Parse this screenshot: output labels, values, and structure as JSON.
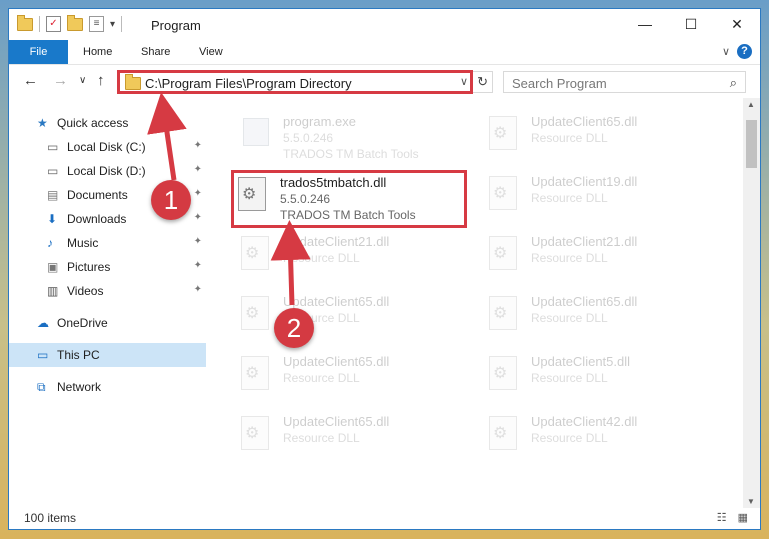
{
  "window": {
    "title": "Program",
    "controls": {
      "minimize": "—",
      "maximize": "☐",
      "close": "✕"
    }
  },
  "ribbon": {
    "tabs": [
      "File",
      "Home",
      "Share",
      "View"
    ],
    "help": "?",
    "expand": "∨"
  },
  "navigation": {
    "back": "←",
    "forward": "→",
    "recent": "∨",
    "up": "↑",
    "address": "C:\\Program Files\\Program Directory",
    "address_dropdown": "∨",
    "refresh": "↻",
    "search_placeholder": "Search Program",
    "search_icon": "⌕"
  },
  "sidebar": {
    "items": [
      {
        "label": "Quick access",
        "icon": "star-icon",
        "pinned": false
      },
      {
        "label": "Local Disk (C:)",
        "icon": "drive-icon",
        "pinned": true
      },
      {
        "label": "Local Disk (D:)",
        "icon": "drive-icon",
        "pinned": true
      },
      {
        "label": "Documents",
        "icon": "documents-icon",
        "pinned": true
      },
      {
        "label": "Downloads",
        "icon": "download-arrow-icon",
        "pinned": true
      },
      {
        "label": "Music",
        "icon": "music-note-icon",
        "pinned": true
      },
      {
        "label": "Pictures",
        "icon": "pictures-icon",
        "pinned": true
      },
      {
        "label": "Videos",
        "icon": "film-icon",
        "pinned": true
      },
      {
        "label": "OneDrive",
        "icon": "cloud-icon",
        "pinned": false
      },
      {
        "label": "This PC",
        "icon": "computer-icon",
        "pinned": false,
        "selected": true
      },
      {
        "label": "Network",
        "icon": "network-icon",
        "pinned": false
      }
    ],
    "pin_glyph": "📌"
  },
  "files": [
    {
      "name": "program.exe",
      "version": "5.5.0.246",
      "desc": "TRADOS TM Batch Tools",
      "faded": true,
      "type": "exe"
    },
    {
      "name": "UpdateClient65.dll",
      "version": "",
      "desc": "Resource DLL",
      "faded": true
    },
    {
      "name": "trados5tmbatch.dll",
      "version": "5.5.0.246",
      "desc": "TRADOS TM Batch Tools",
      "faded": false,
      "highlighted": true
    },
    {
      "name": "UpdateClient19.dll",
      "version": "",
      "desc": "Resource DLL",
      "faded": true
    },
    {
      "name": "UpdateClient21.dll",
      "version": "",
      "desc": "Resource DLL",
      "faded": true
    },
    {
      "name": "UpdateClient21.dll",
      "version": "",
      "desc": "Resource DLL",
      "faded": true
    },
    {
      "name": "UpdateClient65.dll",
      "version": "",
      "desc": "Resource DLL",
      "faded": true
    },
    {
      "name": "UpdateClient65.dll",
      "version": "",
      "desc": "Resource DLL",
      "faded": true
    },
    {
      "name": "UpdateClient65.dll",
      "version": "",
      "desc": "Resource DLL",
      "faded": true
    },
    {
      "name": "UpdateClient5.dll",
      "version": "",
      "desc": "Resource DLL",
      "faded": true
    },
    {
      "name": "UpdateClient65.dll",
      "version": "",
      "desc": "Resource DLL",
      "faded": true
    },
    {
      "name": "UpdateClient42.dll",
      "version": "",
      "desc": "Resource DLL",
      "faded": true
    }
  ],
  "status": {
    "count": "100 items",
    "views": "☷ ▦"
  },
  "callouts": [
    "1",
    "2"
  ],
  "colors": {
    "accent": "#1979ca",
    "highlight": "#d63a43",
    "selection": "#cce4f7"
  }
}
